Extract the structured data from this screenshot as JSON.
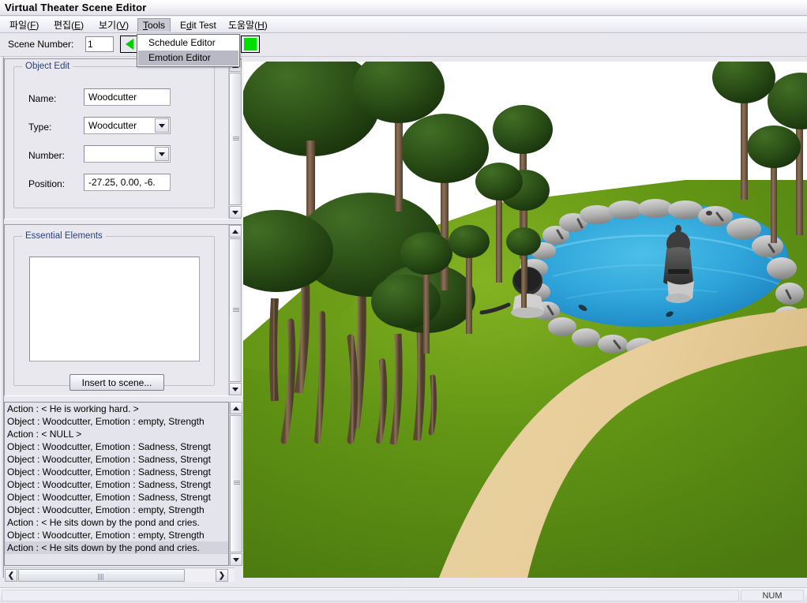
{
  "window": {
    "title": "Virtual Theater Scene Editor"
  },
  "menubar": {
    "items": [
      {
        "name": "file",
        "text": "파일(F)",
        "pre": "파일(",
        "key": "F",
        "post": ")",
        "active": false
      },
      {
        "name": "edit",
        "text": "편집(E)",
        "pre": "편집(",
        "key": "E",
        "post": ")",
        "active": false
      },
      {
        "name": "view",
        "text": "보기(V)",
        "pre": "보기(",
        "key": "V",
        "post": ")",
        "active": false
      },
      {
        "name": "tools",
        "text": "Tools",
        "pre": "T",
        "key": "",
        "post": "ools",
        "active": true
      },
      {
        "name": "edit-test",
        "text": "Edit Test",
        "pre": "E",
        "key": "d",
        "post": "it Test",
        "active": false
      },
      {
        "name": "help",
        "text": "도움말(H)",
        "pre": "도움말(",
        "key": "H",
        "post": ")",
        "active": false
      }
    ]
  },
  "dropdown": {
    "open_for": "Tools",
    "items": [
      {
        "label": "Schedule Editor",
        "selected": false
      },
      {
        "label": "Emotion Editor",
        "selected": true
      }
    ]
  },
  "toolbar": {
    "scene_number_label": "Scene Number:",
    "scene_number_value": "1",
    "scene_number_placeholder": "",
    "prev_button_icon": "arrow-left-green-icon",
    "indicator_icon": "green-square-icon",
    "indicator_color": "#00e000"
  },
  "object_edit": {
    "group_title": "Object Edit",
    "fields": [
      {
        "label": "Name:",
        "value": "Woodcutter",
        "kind": "text"
      },
      {
        "label": "Type:",
        "value": "Woodcutter",
        "kind": "combo"
      },
      {
        "label": "Number:",
        "value": "",
        "kind": "combo"
      },
      {
        "label": "Position:",
        "value": "-27.25, 0.00, -6.",
        "kind": "text"
      }
    ]
  },
  "essential_elements": {
    "group_title": "Essential Elements",
    "list_items": [],
    "insert_button_label": "Insert to scene..."
  },
  "log": {
    "rows": [
      {
        "text": "Action : < He is working hard. >",
        "highlight": false
      },
      {
        "text": "Object : Woodcutter, Emotion : empty, Strength",
        "highlight": false
      },
      {
        "text": "Action : < NULL >",
        "highlight": false
      },
      {
        "text": "Object : Woodcutter, Emotion : Sadness, Strengt",
        "highlight": false
      },
      {
        "text": "Object : Woodcutter, Emotion : Sadness, Strengt",
        "highlight": false
      },
      {
        "text": "Object : Woodcutter, Emotion : Sadness, Strengt",
        "highlight": false
      },
      {
        "text": "Object : Woodcutter, Emotion : Sadness, Strengt",
        "highlight": false
      },
      {
        "text": "Object : Woodcutter, Emotion : Sadness, Strengt",
        "highlight": false
      },
      {
        "text": "Object : Woodcutter, Emotion : empty, Strength",
        "highlight": false
      },
      {
        "text": "Action : < He sits down by the pond and cries.",
        "highlight": false
      },
      {
        "text": "Object : Woodcutter, Emotion : empty, Strength",
        "highlight": false
      },
      {
        "text": "Action : < He sits down by the pond and cries.",
        "highlight": true
      }
    ]
  },
  "statusbar": {
    "message": "",
    "num_indicator": "NUM"
  },
  "viewport": {
    "name": "3d-scene-viewport",
    "description": "3D rendered outdoor scene with trees, pond, stones and a sandy path",
    "sky_color": "#ffffff",
    "grass_color": "#5f8f14",
    "path_color": "#e8cf9c",
    "water_color": "#2fa2d8",
    "rock_color": "#b7b7b7",
    "tree_color": "#2e5219"
  },
  "scrollbars": {
    "object_edit_v": {
      "name": "object-edit-vscroll"
    },
    "essential_v": {
      "name": "essential-elements-vscroll"
    },
    "log_v": {
      "name": "log-vscroll"
    },
    "bottom_h": {
      "name": "left-pane-hscroll",
      "left_icon": "chevron-left-icon",
      "right_icon": "chevron-right-icon"
    }
  }
}
